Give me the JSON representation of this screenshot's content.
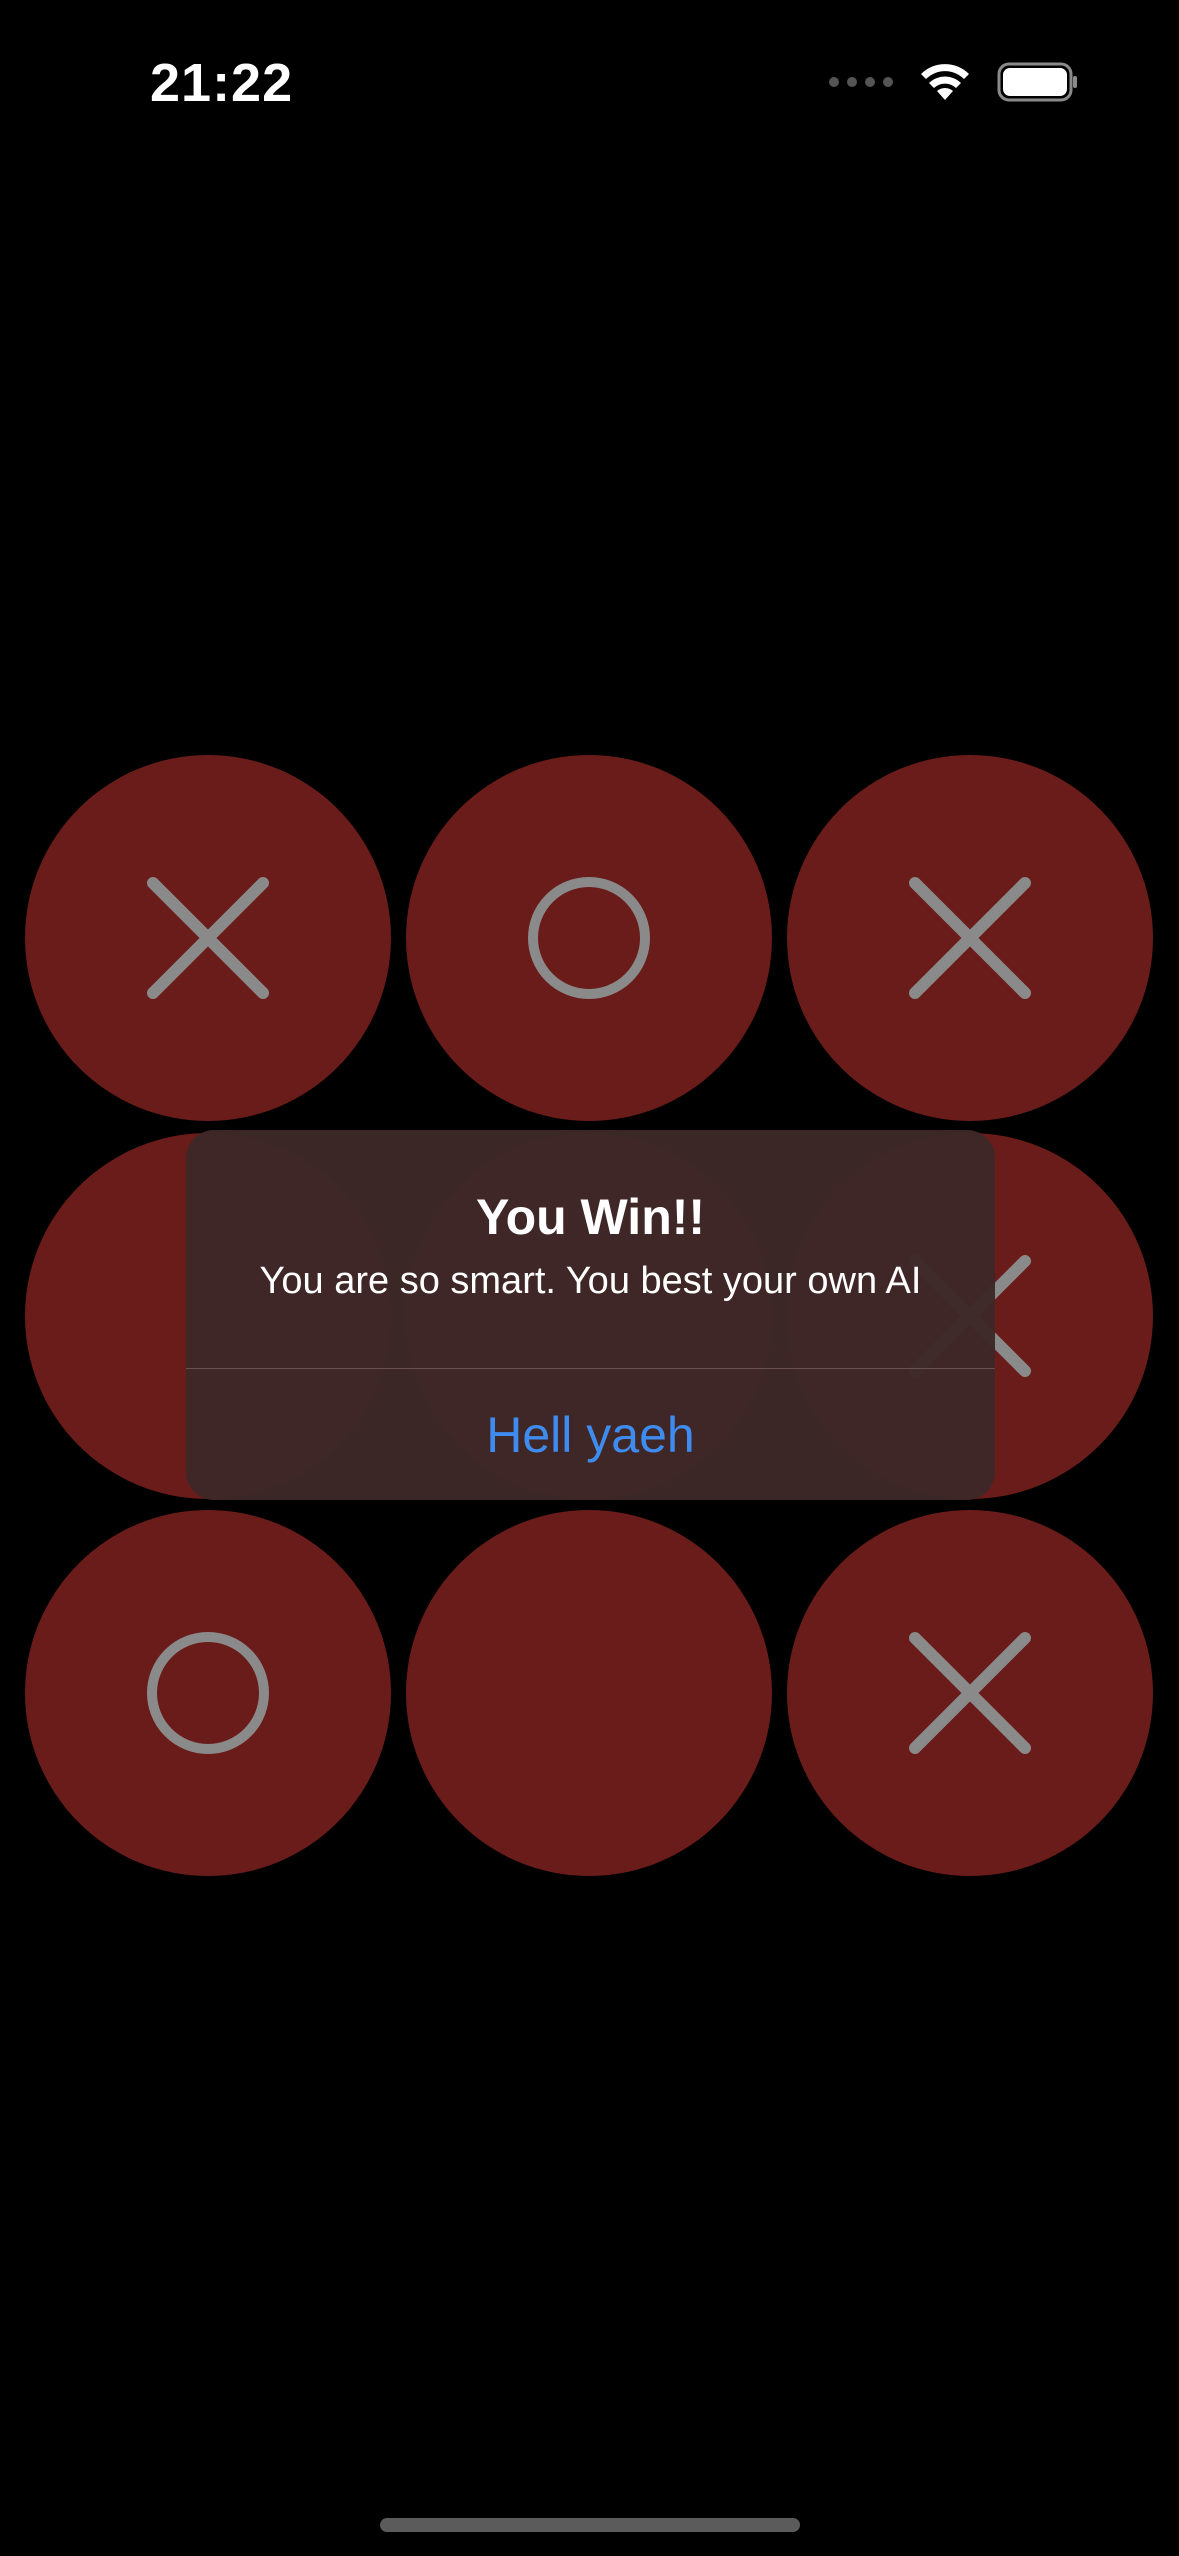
{
  "status_bar": {
    "time": "21:22",
    "wifi_icon": "wifi-icon",
    "battery_icon": "battery-icon"
  },
  "colors": {
    "cell_fill": "#6a1c1a",
    "mark_color": "#8a8a8a",
    "alert_bg": "#3e2828",
    "action_color": "#3f8cf0"
  },
  "board": {
    "cells": [
      "X",
      "O",
      "X",
      "",
      "",
      "X",
      "O",
      "",
      "X"
    ]
  },
  "alert": {
    "title": "You Win!!",
    "message": "You are so smart. You best your own AI",
    "action_label": "Hell yaeh"
  }
}
